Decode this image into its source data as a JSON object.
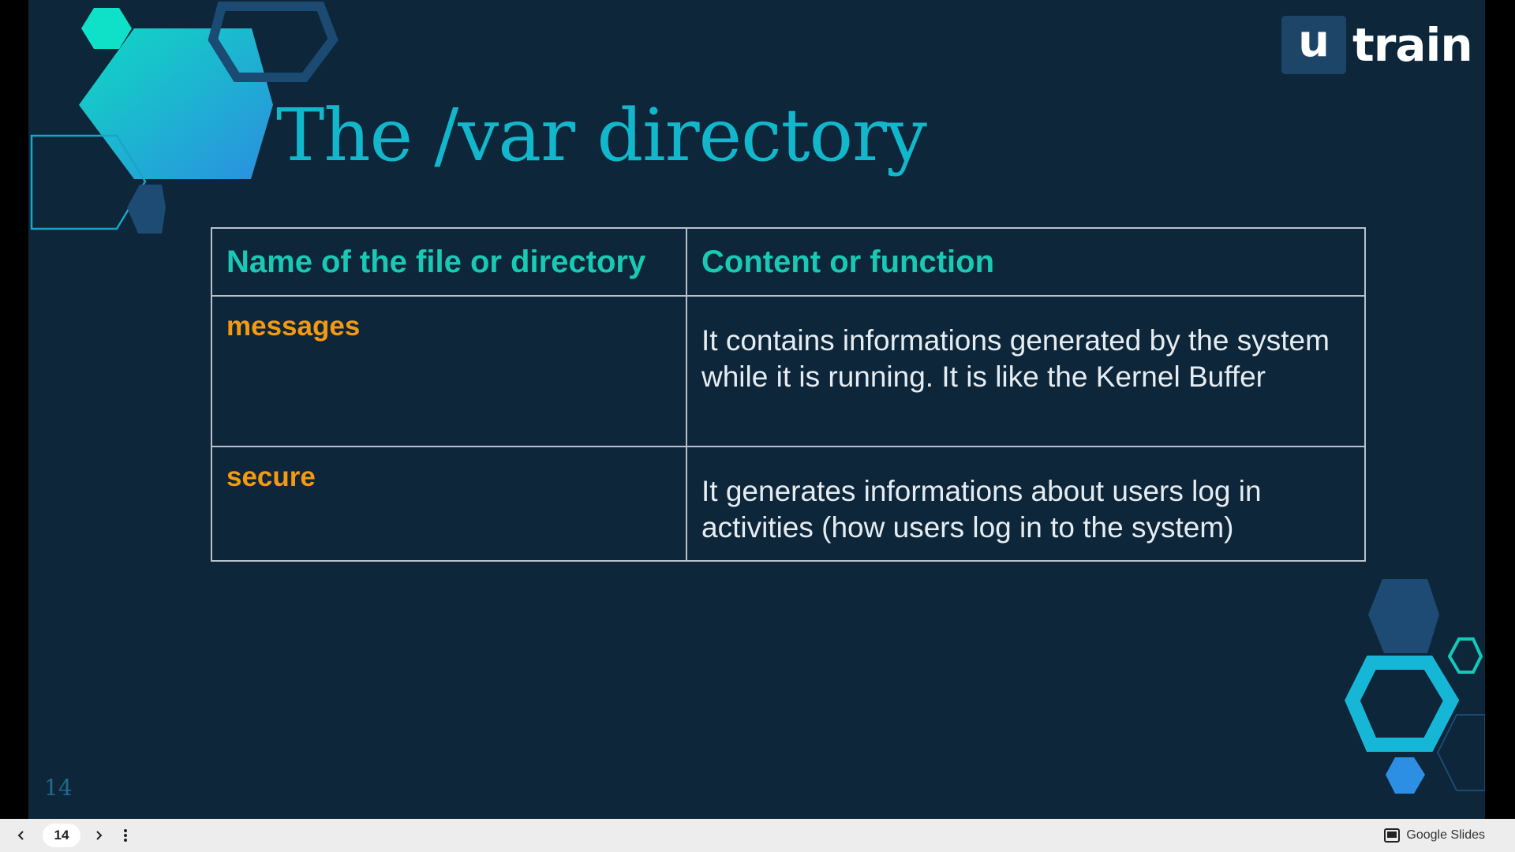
{
  "slide": {
    "title": "The /var directory",
    "page_number": "14",
    "logo": {
      "box_letter": "u",
      "text": "train"
    },
    "table": {
      "headers": [
        "Name of the file or directory",
        "Content or function"
      ],
      "rows": [
        {
          "name": "messages",
          "description": "It contains informations generated by the system while it is running. It is like the Kernel Buffer"
        },
        {
          "name": "secure",
          "description": "It generates informations about users log in activities (how users log in to the system)"
        }
      ]
    }
  },
  "toolbar": {
    "prev_icon": "chevron-left-icon",
    "current_page": "14",
    "next_icon": "chevron-right-icon",
    "more_icon": "more-vertical-icon",
    "brand_label": "Google Slides"
  },
  "colors": {
    "slide_background": "#0e263a",
    "title": "#12b7cc",
    "header_text": "#19c9b4",
    "name_text": "#f49a12",
    "body_text": "#e6edf2"
  }
}
